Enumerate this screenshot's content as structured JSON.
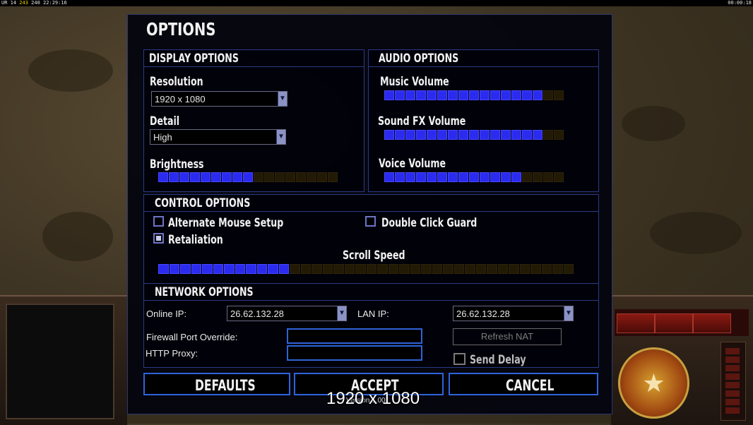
{
  "hud": {
    "top_left": {
      "prefix": "UR 14",
      "fps": "243",
      "fps2": "240",
      "clock": "22:29:16"
    },
    "top_right": "00:00:18"
  },
  "options": {
    "title": "OPTIONS",
    "display": {
      "header": "DISPLAY OPTIONS",
      "resolution_label": "Resolution",
      "resolution_value": "1920 x 1080",
      "detail_label": "Detail",
      "detail_value": "High",
      "brightness_label": "Brightness",
      "brightness_level": 9,
      "brightness_segments": 17
    },
    "audio": {
      "header": "AUDIO OPTIONS",
      "music_label": "Music Volume",
      "music_level": 15,
      "sfx_label": "Sound FX Volume",
      "sfx_level": 15,
      "voice_label": "Voice Volume",
      "voice_level": 13,
      "segments": 17
    },
    "control": {
      "header": "CONTROL OPTIONS",
      "alternate_mouse_label": "Alternate Mouse Setup",
      "alternate_mouse_checked": false,
      "double_click_label": "Double Click Guard",
      "double_click_checked": false,
      "retaliation_label": "Retaliation",
      "retaliation_checked": true,
      "scroll_speed_label": "Scroll Speed",
      "scroll_level": 12,
      "scroll_segments": 38
    },
    "network": {
      "header": "NETWORK OPTIONS",
      "online_ip_label": "Online IP:",
      "online_ip_value": "26.62.132.28",
      "lan_ip_label": "LAN IP:",
      "lan_ip_value": "26.62.132.28",
      "firewall_label": "Firewall Port Override:",
      "firewall_value": "",
      "http_proxy_label": "HTTP Proxy:",
      "http_proxy_value": "",
      "refresh_nat_label": "Refresh NAT",
      "send_delay_label": "Send Delay",
      "send_delay_checked": false
    },
    "buttons": {
      "defaults": "DEFAULTS",
      "accept": "ACCEPT",
      "cancel": "CANCEL"
    },
    "version": "Version 1.00"
  },
  "overlay": {
    "resolution_text": "1920 x 1080"
  },
  "colors": {
    "accent": "#2d63dc",
    "slider_on": "#2b2bf0",
    "slider_off": "#231a06",
    "panel_border": "#2b3a86"
  },
  "icons": {
    "dropdown_arrow": "chevron-down-icon",
    "emblem": "star-icon"
  }
}
